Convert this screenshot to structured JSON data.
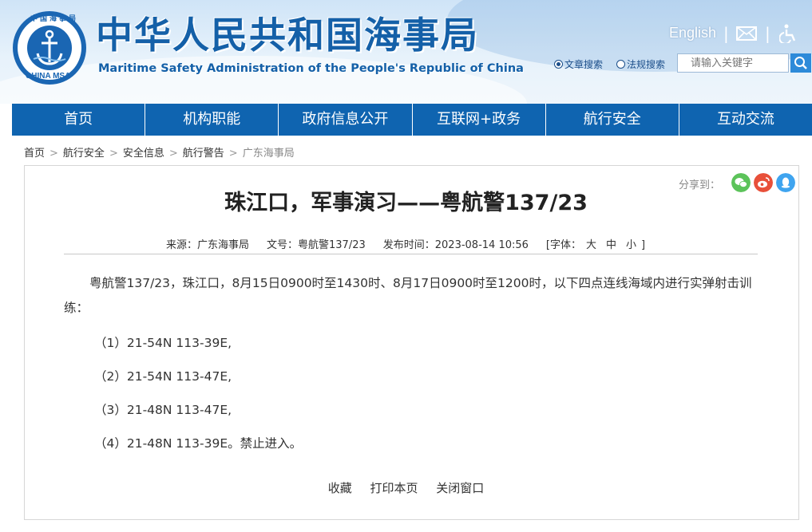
{
  "header": {
    "logo_text_cn": "中国海事局",
    "logo_text_en": "CHINA MSA",
    "title_cn": "中华人民共和国海事局",
    "title_en": "Maritime Safety Administration of the People's Republic of China",
    "english_link": "English",
    "separator": "|",
    "search": {
      "option_article": "文章搜索",
      "option_law": "法规搜索",
      "selected": "文章搜索",
      "placeholder": "请输入关键字"
    }
  },
  "nav": [
    "首页",
    "机构职能",
    "政府信息公开",
    "互联网+政务",
    "航行安全",
    "互动交流"
  ],
  "breadcrumb": {
    "items": [
      "首页",
      "航行安全",
      "安全信息",
      "航行警告"
    ],
    "separator": ">",
    "current": "广东海事局"
  },
  "share": {
    "label": "分享到：",
    "icons": [
      "wechat-icon",
      "weibo-icon",
      "qq-icon"
    ]
  },
  "article": {
    "title": "珠江口，军事演习——粤航警137/23",
    "source": "来源：广东海事局",
    "doc_no": "文号：粤航警137/23",
    "publish_time": "发布时间：2023-08-14 10:56",
    "font_size_prefix": "[字体：",
    "font_large": "大",
    "font_medium": "中",
    "font_small": "小",
    "font_size_suffix": "]",
    "paragraph": "粤航警137/23，珠江口，8月15日0900时至1430时、8月17日0900时至1200时，以下四点连线海域内进行实弹射击训练：",
    "points": [
      "（1）21-54N 113-39E,",
      "（2）21-54N 113-47E,",
      "（3）21-48N 113-47E,",
      "（4）21-48N 113-39E。禁止进入。"
    ]
  },
  "actions": {
    "favorite": "收藏",
    "print": "打印本页",
    "close": "关闭窗口"
  },
  "colors": {
    "brand_blue": "#1460a8",
    "nav_blue": "#0f64b0",
    "wechat": "#5cc35a",
    "weibo": "#e8503a",
    "qq": "#3fa4ef"
  }
}
